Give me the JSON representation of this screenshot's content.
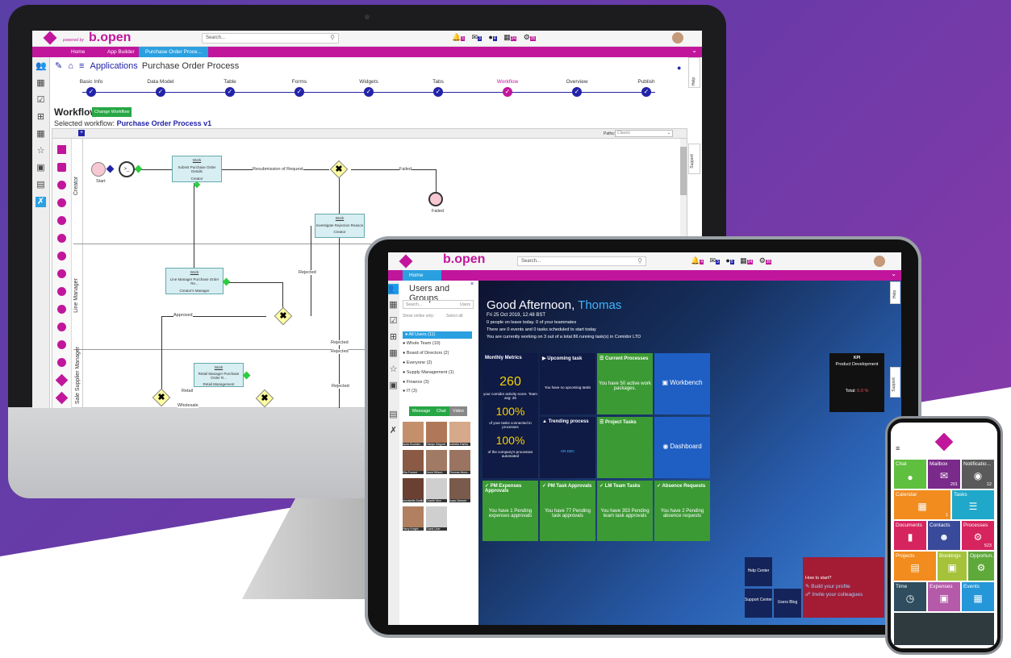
{
  "desktop": {
    "brand": {
      "powered_by": "powered by",
      "logo": "b.open"
    },
    "search_placeholder": "Search...",
    "notif_counts": [
      "5",
      "3",
      "4",
      "24",
      "35"
    ],
    "menu": {
      "home": "Home",
      "app_builder": "App Builder",
      "active_tab": "Purchase Order Proce..."
    },
    "breadcrumb": {
      "applications": "Applications",
      "name": "Purchase Order Process"
    },
    "steps": [
      "Basic Info",
      "Data Model",
      "Table",
      "Forms",
      "Widgets",
      "Tabs",
      "Workflow",
      "Overview",
      "Publish"
    ],
    "workflow_title": "Workflow",
    "change_btn": "Change Workflow",
    "selected_label": "Selected workflow:",
    "selected_name": "Purchase Order Process v1",
    "paths_label": "Paths:",
    "paths_value": "Classic",
    "lanes": [
      "Creator",
      "Line Manager",
      "Sale Supplier Manager"
    ],
    "nodes": {
      "work1": {
        "t": "Work",
        "s": "Submit Purchase Order Details",
        "r": "Creator"
      },
      "work2": {
        "t": "Work",
        "s": "Investigate Rejection Reason",
        "r": "Creator"
      },
      "work3": {
        "t": "Work",
        "s": "Line Manager Purchase Order Re...",
        "r": "Creator's Manager"
      },
      "work4": {
        "t": "Work",
        "s": "Retail Manager Purchase Order R...",
        "r": "Retail Management"
      }
    },
    "labels": {
      "start": "Start",
      "failed_end": "Failed",
      "resub": "Resubmission of Request",
      "failed": "Failed",
      "rejected1": "Rejected",
      "approved": "Approved",
      "rejected2": "Rejected",
      "rejected3": "Rejected",
      "rejected4": "Rejected",
      "retail": "Retail",
      "wholesale": "Wholesale"
    },
    "help": "Help",
    "support": "Support"
  },
  "tablet": {
    "logo": "b.open",
    "search_placeholder": "Search...",
    "notif_counts": [
      "4",
      "3",
      "5",
      "24",
      "35"
    ],
    "menu_home": "Home",
    "users_title": "Users and Groups",
    "users_search": "Search...",
    "users_filter": "Users",
    "show_online": "Show online only:",
    "select_all": "Select all:",
    "groups": [
      "All Users (11)",
      "Whole Team (10)",
      "Board of Directors (2)",
      "Everyone (2)",
      "Supply Management (1)",
      "Finance (3)",
      "IT (3)"
    ],
    "buttons": {
      "message": "Message",
      "chat": "Chat",
      "video": "Video"
    },
    "people": [
      "Ayda Scudder...",
      "Gladys Dalgord",
      "Isabella Harley",
      "Ella Forrest",
      "David Wilson",
      "Thomas Mono...",
      "Annabelle Smith",
      "Charlie Mon",
      "Isaac Weaver",
      "Harry Knight",
      "Guest User"
    ],
    "greeting": "Good Afternoon,",
    "user": "Thomas",
    "date": "Fri 25 Oct 2019, 12:48 BST",
    "line1": "0 people on leave today. 0 of your teammates",
    "line2": "There are 0 events and 0 tasks scheduled to start today",
    "line3": "You are currently working on 3 out of a total 86 running task(s) in Comidor LTD",
    "metrics": {
      "title": "Monthly Metrics",
      "v1": "260",
      "d1": "your comidor activity score. Team avg: 26",
      "v2": "100%",
      "d2": "of your tasks connected to processes",
      "v3": "100%",
      "d3": "of the company's processes automated"
    },
    "upcoming": {
      "title": "Upcoming task",
      "body": "You have no upcoming tasks"
    },
    "trending": {
      "title": "Trending process",
      "body": "HR.DBC"
    },
    "current": {
      "title": "Current Processes",
      "body": "You have 50 active work packages."
    },
    "project_tasks": "Project Tasks",
    "workbench": "Workbench",
    "dashboard": "Dashboard",
    "kpi": {
      "title": "KPI",
      "sub": "Product Development",
      "total_label": "Total:",
      "total": "0.0 %"
    },
    "approvals": [
      {
        "title": "PM Expenses Approvals",
        "body": "You have 1 Pending expenses approvals"
      },
      {
        "title": "PM Task Approvals",
        "body": "You have 77 Pending task approvals"
      },
      {
        "title": "LM Team Tasks",
        "body": "You have 353 Pending team task approvals"
      },
      {
        "title": "Absence Requests",
        "body": "You have 2 Pending absence requests"
      }
    ],
    "help_center": "Help Center",
    "support_center": "Support Center",
    "users_blog": "Users Blog",
    "howto": {
      "title": "How to start?",
      "a": "Build your profile",
      "b": "Invite your colleagues"
    },
    "help": "Help",
    "support": "Support"
  },
  "phone": {
    "tiles": [
      {
        "label": "Chat",
        "n": ""
      },
      {
        "label": "Mailbox",
        "n": "201"
      },
      {
        "label": "Notificatio...",
        "n": "12"
      },
      {
        "label": "Calendar",
        "n": "1"
      },
      {
        "label": "Tasks",
        "n": ""
      },
      {
        "label": "Documents",
        "n": ""
      },
      {
        "label": "Contacts",
        "n": ""
      },
      {
        "label": "Processes",
        "n": "523"
      },
      {
        "label": "Projects",
        "n": ""
      },
      {
        "label": "Bookings",
        "n": ""
      },
      {
        "label": "Opportun...",
        "n": ""
      },
      {
        "label": "Time",
        "n": ""
      },
      {
        "label": "Expenses",
        "n": ""
      },
      {
        "label": "Events",
        "n": ""
      }
    ]
  },
  "colors": {
    "magenta": "#c1169c",
    "navy": "#2323a8",
    "green": "#3c9a34",
    "blue": "#1f5fc4"
  }
}
